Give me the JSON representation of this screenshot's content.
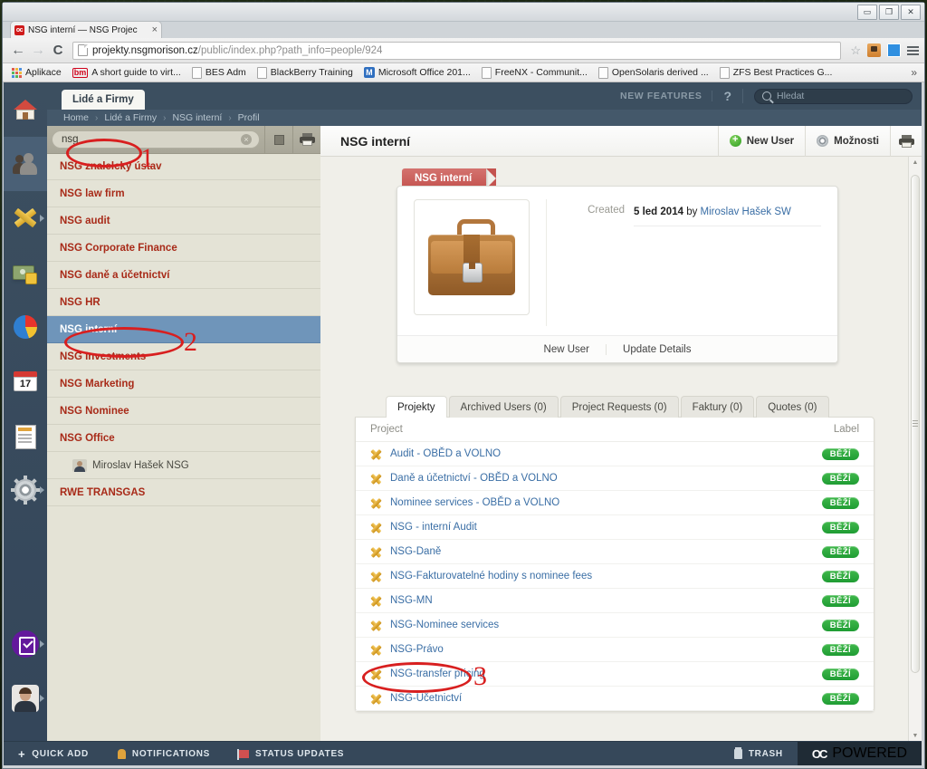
{
  "browser": {
    "tab_title": "NSG interní — NSG Projec",
    "tab_favicon": "oc",
    "tab_close": "×",
    "back_icon": "←",
    "forward_icon": "→",
    "reload_icon": "C",
    "url_host": "projekty.nsgmorison.cz",
    "url_path": "/public/index.php?path_info=people/924",
    "star_icon": "☆",
    "window_minimize": "▭",
    "window_restore": "❐",
    "window_close": "✕",
    "bookmarks": [
      {
        "label": "Aplikace",
        "icon": "apps-grid-icon"
      },
      {
        "label": "A short guide to virt...",
        "icon": "bm-icon"
      },
      {
        "label": "BES Adm",
        "icon": "page-icon"
      },
      {
        "label": "BlackBerry Training",
        "icon": "page-icon"
      },
      {
        "label": "Microsoft Office 201...",
        "icon": "m-icon"
      },
      {
        "label": "FreeNX - Communit...",
        "icon": "page-icon"
      },
      {
        "label": "OpenSolaris derived ...",
        "icon": "page-icon"
      },
      {
        "label": "ZFS Best Practices G...",
        "icon": "page-icon"
      }
    ],
    "bookmarks_overflow": "»"
  },
  "app": {
    "module_tab": "Lidé a Firmy",
    "breadcrumb": [
      "Home",
      "Lidé a Firmy",
      "NSG interní",
      "Profil"
    ],
    "breadcrumb_sep": "›",
    "topbar": {
      "new_features": "NEW FEATURES",
      "help": "?",
      "search_placeholder": "Hledat"
    }
  },
  "people_panel": {
    "search_value": "nsg",
    "clear_icon": "×",
    "toolbar_buttons": [
      "view-toggle-button",
      "print-button"
    ],
    "items": [
      {
        "label": "NSG znalelcký ústav",
        "type": "company",
        "selected": false
      },
      {
        "label": "NSG law firm",
        "type": "company",
        "selected": false
      },
      {
        "label": "NSG audit",
        "type": "company",
        "selected": false
      },
      {
        "label": "NSG Corporate Finance",
        "type": "company",
        "selected": false
      },
      {
        "label": "NSG daně a účetnictví",
        "type": "company",
        "selected": false
      },
      {
        "label": "NSG HR",
        "type": "company",
        "selected": false
      },
      {
        "label": "NSG interní",
        "type": "company",
        "selected": true
      },
      {
        "label": "NSG Investments",
        "type": "company",
        "selected": false
      },
      {
        "label": "NSG Marketing",
        "type": "company",
        "selected": false
      },
      {
        "label": "NSG Nominee",
        "type": "company",
        "selected": false
      },
      {
        "label": "NSG Office",
        "type": "company",
        "selected": false
      },
      {
        "label": "Miroslav Hašek NSG",
        "type": "person",
        "selected": false
      },
      {
        "label": "RWE TRANSGAS",
        "type": "company",
        "selected": false
      }
    ]
  },
  "main": {
    "title": "NSG interní",
    "actions": {
      "new_user": "New User",
      "options": "Možnosti",
      "print": "print-icon"
    },
    "card": {
      "ribbon": "NSG interní",
      "avatar_icon": "briefcase-icon",
      "created_label": "Created",
      "created_value": "5 led 2014",
      "created_by_word": "by",
      "created_by_name": "Miroslav Hašek SW",
      "footer_links": [
        "New User",
        "Update Details"
      ]
    },
    "tabs": [
      {
        "label": "Projekty",
        "active": true
      },
      {
        "label": "Archived Users (0)",
        "active": false
      },
      {
        "label": "Project Requests (0)",
        "active": false
      },
      {
        "label": "Faktury (0)",
        "active": false
      },
      {
        "label": "Quotes (0)",
        "active": false
      }
    ],
    "table": {
      "columns": [
        "Project",
        "Label"
      ],
      "rows": [
        {
          "project": "Audit - OBĚD a VOLNO",
          "label": "BĚŽÍ"
        },
        {
          "project": "Daně a účetnictví - OBĚD a VOLNO",
          "label": "BĚŽÍ"
        },
        {
          "project": "Nominee services - OBĚD a VOLNO",
          "label": "BĚŽÍ"
        },
        {
          "project": "NSG - interní Audit",
          "label": "BĚŽÍ"
        },
        {
          "project": "NSG-Daně",
          "label": "BĚŽÍ"
        },
        {
          "project": "NSG-Fakturovatelné hodiny s nominee fees",
          "label": "BĚŽÍ"
        },
        {
          "project": "NSG-MN",
          "label": "BĚŽÍ"
        },
        {
          "project": "NSG-Nominee services",
          "label": "BĚŽÍ"
        },
        {
          "project": "NSG-Právo",
          "label": "BĚŽÍ"
        },
        {
          "project": "NSG-transfer pricing",
          "label": "BĚŽÍ"
        },
        {
          "project": "NSG-Účetnictví",
          "label": "BĚŽÍ"
        }
      ]
    }
  },
  "statusbar": {
    "quick_add": "QUICK ADD",
    "notifications": "NOTIFICATIONS",
    "status_updates": "STATUS UPDATES",
    "trash": "TRASH",
    "powered": "POWERED",
    "powered_logo": "OC"
  },
  "annotations": [
    {
      "number": "1",
      "target": "search-input"
    },
    {
      "number": "2",
      "target": "people-item-nsg-interni"
    },
    {
      "number": "3",
      "target": "project-nsg-pravo"
    }
  ],
  "colors": {
    "annotation_red": "#d81f1f",
    "selection_blue": "#6f95ba",
    "badge_green": "#2aa53a",
    "company_red": "#a82a18",
    "link_blue": "#3a6ea5",
    "ribbon_red": "#c4534f"
  }
}
